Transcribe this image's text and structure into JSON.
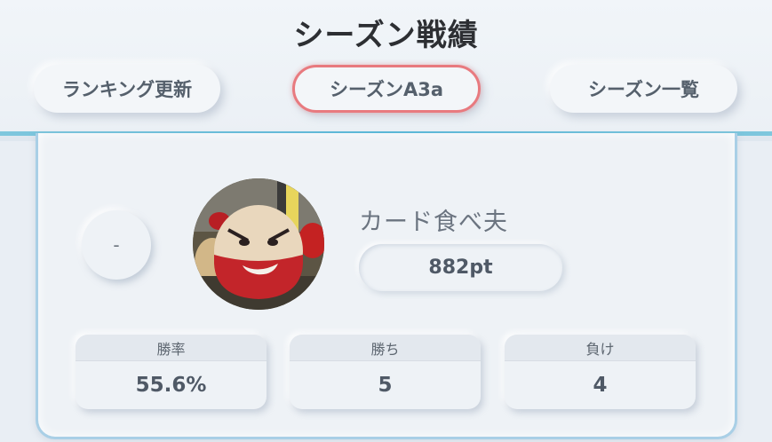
{
  "title": "シーズン戦績",
  "tabs": [
    {
      "label": "ランキング更新"
    },
    {
      "label": "シーズンA3a"
    },
    {
      "label": "シーズン一覧"
    }
  ],
  "player": {
    "rank": "-",
    "name": "カード食べ夫",
    "points": "882pt"
  },
  "stats": [
    {
      "label": "勝率",
      "value": "55.6%"
    },
    {
      "label": "勝ち",
      "value": "5"
    },
    {
      "label": "負け",
      "value": "4"
    }
  ],
  "colors": {
    "accent_active": "#e87a7f",
    "header_line": "#58b9d9",
    "card_border": "#a9cfe6"
  }
}
